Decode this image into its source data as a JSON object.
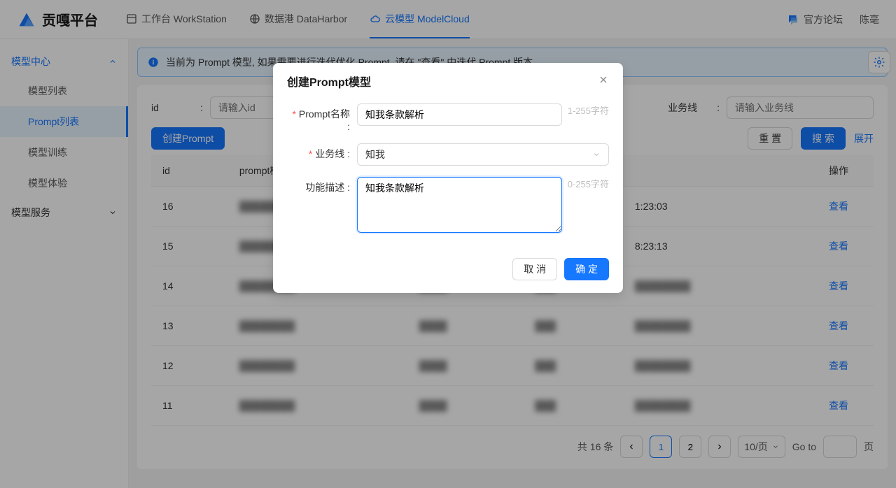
{
  "header": {
    "logo_text": "贡嘎平台",
    "tabs": [
      {
        "label": "工作台 WorkStation"
      },
      {
        "label": "数据港 DataHarbor"
      },
      {
        "label": "云模型 ModelCloud"
      }
    ],
    "forum_label": "官方论坛",
    "user_name": "陈毫"
  },
  "sidebar": {
    "groups": [
      {
        "label": "模型中心",
        "expanded": true,
        "items": [
          {
            "label": "模型列表"
          },
          {
            "label": "Prompt列表",
            "active": true
          },
          {
            "label": "模型训练"
          },
          {
            "label": "模型体验"
          }
        ]
      },
      {
        "label": "模型服务",
        "expanded": false,
        "items": []
      }
    ]
  },
  "banner": {
    "text": "当前为 Prompt 模型, 如果需要进行迭代优化 Prompt, 请在 \"查看\" 中迭代 Prompt 版本."
  },
  "search": {
    "id_label": "id",
    "id_placeholder": "请输入id",
    "biz_label": "业务线",
    "biz_placeholder": "请输入业务线",
    "reset_label": "重 置",
    "search_label": "搜 索",
    "expand_label": "展开"
  },
  "actions": {
    "create_prompt_label": "创建Prompt"
  },
  "table": {
    "columns": {
      "id": "id",
      "name": "prompt模",
      "action": "操作"
    },
    "rows": [
      {
        "id": "16",
        "time": "1:23:03",
        "action": "查看"
      },
      {
        "id": "15",
        "time": "8:23:13",
        "action": "查看"
      },
      {
        "id": "14",
        "time": "",
        "action": "查看"
      },
      {
        "id": "13",
        "time": "",
        "action": "查看"
      },
      {
        "id": "12",
        "time": "",
        "action": "查看"
      },
      {
        "id": "11",
        "time": "",
        "action": "查看"
      }
    ]
  },
  "pagination": {
    "total_text": "共 16 条",
    "page1": "1",
    "page2": "2",
    "size_label": "10/页",
    "goto_label": "Go to",
    "page_suffix": "页"
  },
  "modal": {
    "title": "创建Prompt模型",
    "name_label": "Prompt名称 :",
    "name_value": "知我条款解析",
    "name_hint": "1-255字符",
    "biz_label": "业务线 :",
    "biz_value": "知我",
    "desc_label": "功能描述 :",
    "desc_value": "知我条款解析",
    "desc_hint": "0-255字符",
    "cancel_label": "取 消",
    "ok_label": "确 定"
  }
}
